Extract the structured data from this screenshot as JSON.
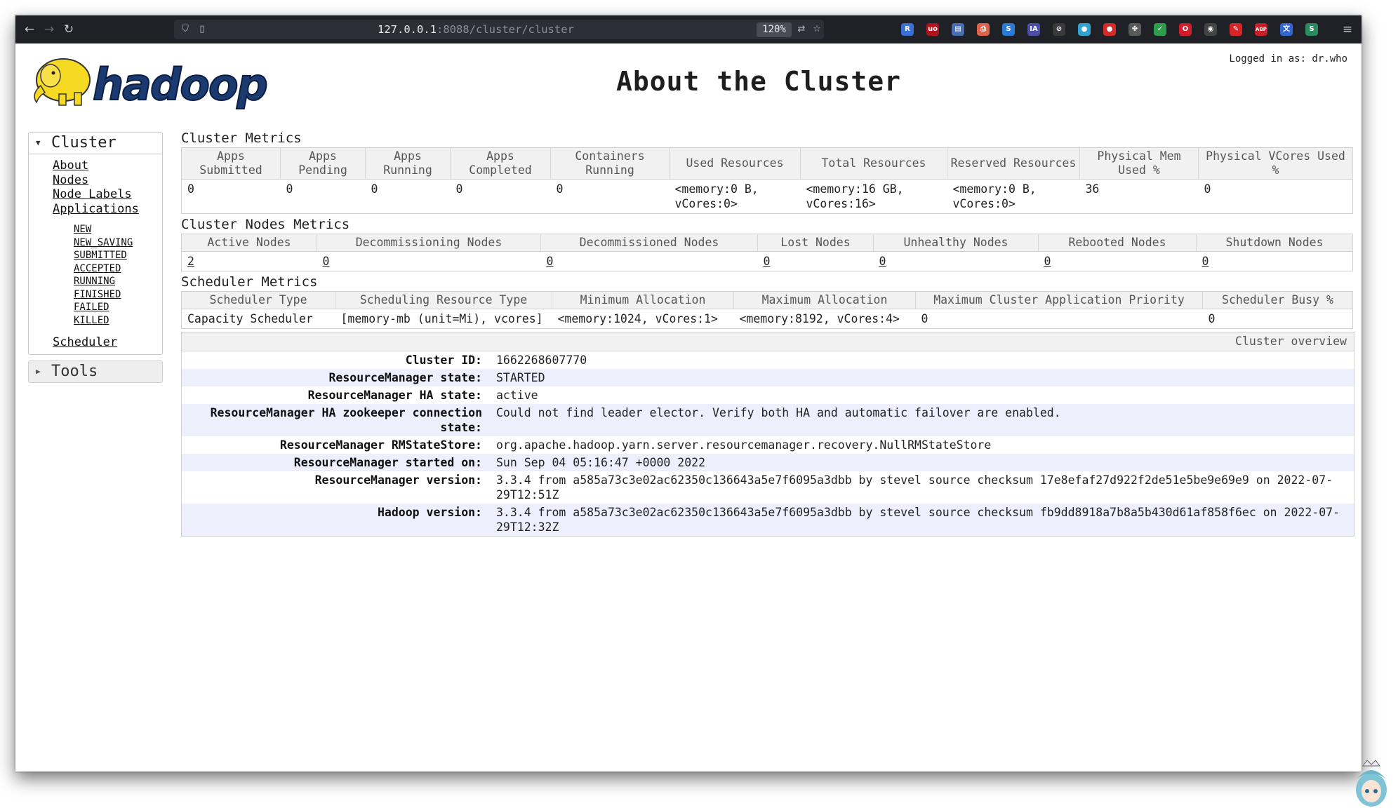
{
  "browser": {
    "url_host": "127.0.0.1",
    "url_path": ":8088/cluster/cluster",
    "zoom": "120%"
  },
  "header": {
    "logo_text": "hadoop",
    "title": "About the Cluster",
    "logged_in": "Logged in as: dr.who"
  },
  "sidebar": {
    "cluster_label": "Cluster",
    "links": [
      "About",
      "Nodes",
      "Node Labels",
      "Applications"
    ],
    "app_states": [
      "NEW",
      "NEW_SAVING",
      "SUBMITTED",
      "ACCEPTED",
      "RUNNING",
      "FINISHED",
      "FAILED",
      "KILLED"
    ],
    "scheduler": "Scheduler",
    "tools_label": "Tools"
  },
  "cluster_metrics": {
    "title": "Cluster Metrics",
    "headers": [
      "Apps Submitted",
      "Apps Pending",
      "Apps Running",
      "Apps Completed",
      "Containers Running",
      "Used Resources",
      "Total Resources",
      "Reserved Resources",
      "Physical Mem Used %",
      "Physical VCores Used %"
    ],
    "values": [
      "0",
      "0",
      "0",
      "0",
      "0",
      "<memory:0 B, vCores:0>",
      "<memory:16 GB, vCores:16>",
      "<memory:0 B, vCores:0>",
      "36",
      "0"
    ]
  },
  "node_metrics": {
    "title": "Cluster Nodes Metrics",
    "headers": [
      "Active Nodes",
      "Decommissioning Nodes",
      "Decommissioned Nodes",
      "Lost Nodes",
      "Unhealthy Nodes",
      "Rebooted Nodes",
      "Shutdown Nodes"
    ],
    "values": [
      "2",
      "0",
      "0",
      "0",
      "0",
      "0",
      "0"
    ]
  },
  "scheduler_metrics": {
    "title": "Scheduler Metrics",
    "headers": [
      "Scheduler Type",
      "Scheduling Resource Type",
      "Minimum Allocation",
      "Maximum Allocation",
      "Maximum Cluster Application Priority",
      "Scheduler Busy %"
    ],
    "values": [
      "Capacity Scheduler",
      "[memory-mb (unit=Mi), vcores]",
      "<memory:1024, vCores:1>",
      "<memory:8192, vCores:4>",
      "0",
      "0"
    ]
  },
  "overview": {
    "title": "Cluster overview",
    "rows": [
      {
        "label": "Cluster ID:",
        "value": "1662268607770"
      },
      {
        "label": "ResourceManager state:",
        "value": "STARTED"
      },
      {
        "label": "ResourceManager HA state:",
        "value": "active"
      },
      {
        "label": "ResourceManager HA zookeeper connection state:",
        "value": "Could not find leader elector. Verify both HA and automatic failover are enabled."
      },
      {
        "label": "ResourceManager RMStateStore:",
        "value": "org.apache.hadoop.yarn.server.resourcemanager.recovery.NullRMStateStore"
      },
      {
        "label": "ResourceManager started on:",
        "value": "Sun Sep 04 05:16:47 +0000 2022"
      },
      {
        "label": "ResourceManager version:",
        "value": "3.3.4 from a585a73c3e02ac62350c136643a5e7f6095a3dbb by stevel source checksum 17e8efaf27d922f2de51e5be9e69e9 on 2022-07-29T12:51Z"
      },
      {
        "label": "Hadoop version:",
        "value": "3.3.4 from a585a73c3e02ac62350c136643a5e7f6095a3dbb by stevel source checksum fb9dd8918a7b8a5b430d61af858f6ec on 2022-07-29T12:32Z"
      }
    ]
  },
  "extensions": [
    {
      "name": "bitwarden-icon",
      "label": "R",
      "color": "#3b6fd8"
    },
    {
      "name": "ublock-icon",
      "label": "uo",
      "color": "#b0131e"
    },
    {
      "name": "tab-manager-icon",
      "label": "▤",
      "color": "#4a6fb0"
    },
    {
      "name": "pdf-icon",
      "label": "⎙",
      "color": "#e0624a"
    },
    {
      "name": "stylus-icon",
      "label": "S",
      "color": "#2a7bd6"
    },
    {
      "name": "ia-icon",
      "label": "IA",
      "color": "#4b4fa8"
    },
    {
      "name": "compass-icon",
      "label": "⊘",
      "color": "#3a3a3a"
    },
    {
      "name": "colorful-icon",
      "label": "●",
      "color": "#2fa3d1"
    },
    {
      "name": "record-icon",
      "label": "●",
      "color": "#d42a2a"
    },
    {
      "name": "puzzle-icon",
      "label": "✤",
      "color": "#5a5a5a"
    },
    {
      "name": "shield-icon",
      "label": "✓",
      "color": "#2f9e4a"
    },
    {
      "name": "opera-icon",
      "label": "O",
      "color": "#d21b2b"
    },
    {
      "name": "ghost-icon",
      "label": "◉",
      "color": "#444"
    },
    {
      "name": "feather-icon",
      "label": "✎",
      "color": "#d92525"
    },
    {
      "name": "adblock-icon",
      "label": "ABP",
      "color": "#c8202a"
    },
    {
      "name": "translate-icon",
      "label": "文",
      "color": "#3367d6"
    },
    {
      "name": "s-green-icon",
      "label": "S",
      "color": "#2c8b5e"
    }
  ]
}
